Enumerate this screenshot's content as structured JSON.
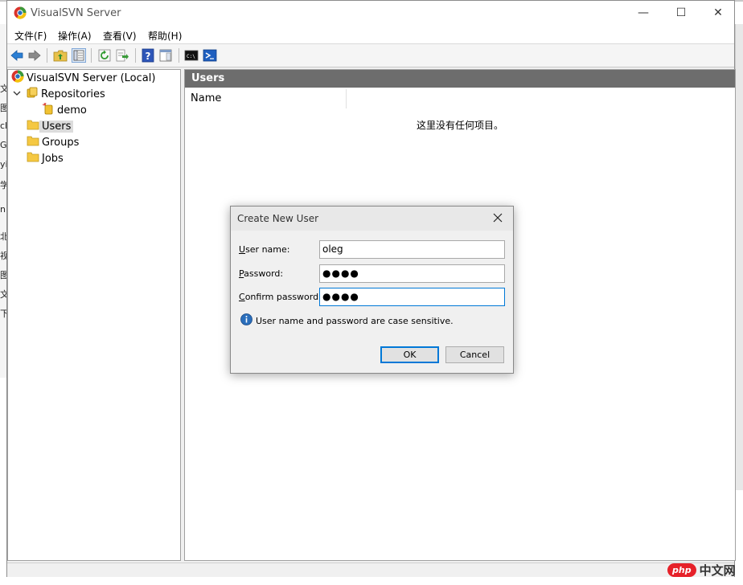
{
  "background": {
    "left_glyphs": [
      "文",
      "图",
      "cl",
      "G",
      "yi",
      "学",
      "n",
      "北",
      "视",
      "图",
      "文",
      "下"
    ]
  },
  "window": {
    "title": "VisualSVN Server",
    "controls": {
      "minimize": "—",
      "maximize": "☐",
      "close": "✕"
    }
  },
  "menu": {
    "items": [
      "文件(F)",
      "操作(A)",
      "查看(V)",
      "帮助(H)"
    ]
  },
  "toolbar": {
    "icons": [
      "back-arrow-icon",
      "forward-arrow-icon",
      "up-folder-icon",
      "show-hide-tree-icon",
      "refresh-icon",
      "export-list-icon",
      "help-icon",
      "properties-pane-icon",
      "command-prompt-icon",
      "powershell-icon"
    ]
  },
  "tree": {
    "root": "VisualSVN Server (Local)",
    "repositories": "Repositories",
    "repo_demo": "demo",
    "users": "Users",
    "groups": "Groups",
    "jobs": "Jobs"
  },
  "content": {
    "header": "Users",
    "column_name": "Name",
    "empty_message": "这里没有任何项目。"
  },
  "dialog": {
    "title": "Create New User",
    "username_label_accel": "U",
    "username_label_rest": "ser name:",
    "username_value": "oleg",
    "password_label_accel": "P",
    "password_label_rest": "assword:",
    "password_value": "●●●●",
    "confirm_label_accel": "C",
    "confirm_label_rest": "onfirm password:",
    "confirm_value": "●●●●",
    "info_text": "User name and password are case sensitive.",
    "ok_label": "OK",
    "cancel_label": "Cancel"
  },
  "watermark": {
    "badge": "php",
    "text": "中文网"
  },
  "colors": {
    "pane_header": "#6d6d6d",
    "focus_border": "#0078d7",
    "folder_yellow": "#f5c842",
    "info_blue": "#2a6ebb"
  }
}
